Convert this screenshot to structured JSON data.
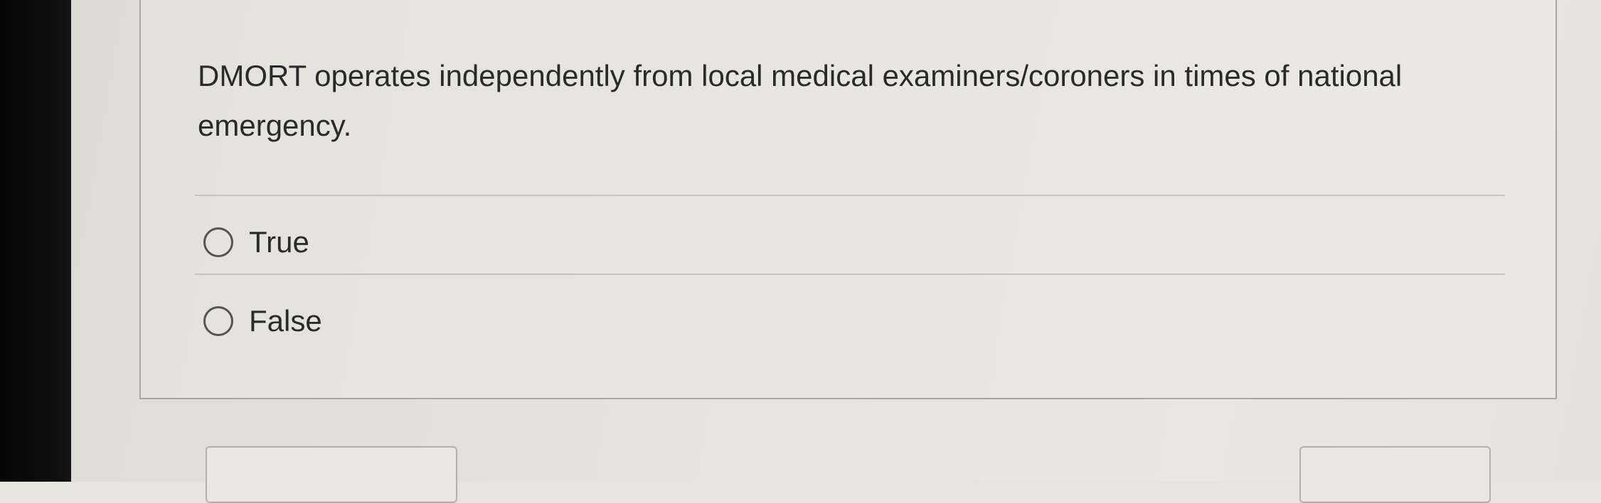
{
  "question": {
    "text": "DMORT operates independently from local medical examiners/coroners in times of national emergency."
  },
  "options": [
    {
      "label": "True",
      "selected": false
    },
    {
      "label": "False",
      "selected": false
    }
  ],
  "navigation": {
    "previous_label": "",
    "next_label": ""
  },
  "colors": {
    "text": "#2a2a2a",
    "card_border": "#a9a7a2",
    "divider": "#c6c4bf",
    "radio_border": "#555555"
  }
}
